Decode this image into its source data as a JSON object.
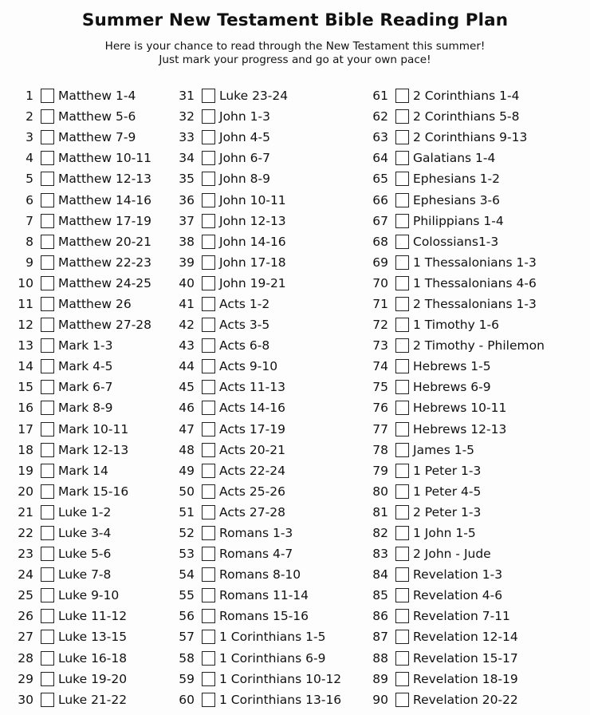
{
  "title": "Summer New Testament Bible Reading Plan",
  "subtitle_lines": [
    "Here is your chance to read through the New Testament this summer!",
    "Just mark your progress and go at your own pace!"
  ],
  "readings": [
    {
      "n": "1",
      "label": "Matthew 1-4",
      "checked": false
    },
    {
      "n": "2",
      "label": "Matthew 5-6",
      "checked": false
    },
    {
      "n": "3",
      "label": "Matthew 7-9",
      "checked": false
    },
    {
      "n": "4",
      "label": "Matthew 10-11",
      "checked": false
    },
    {
      "n": "5",
      "label": "Matthew 12-13",
      "checked": false
    },
    {
      "n": "6",
      "label": "Matthew 14-16",
      "checked": false
    },
    {
      "n": "7",
      "label": "Matthew 17-19",
      "checked": false
    },
    {
      "n": "8",
      "label": "Matthew 20-21",
      "checked": false
    },
    {
      "n": "9",
      "label": "Matthew 22-23",
      "checked": false
    },
    {
      "n": "10",
      "label": "Matthew 24-25",
      "checked": false
    },
    {
      "n": "11",
      "label": "Matthew 26",
      "checked": false
    },
    {
      "n": "12",
      "label": "Matthew 27-28",
      "checked": false
    },
    {
      "n": "13",
      "label": "Mark 1-3",
      "checked": false
    },
    {
      "n": "14",
      "label": "Mark 4-5",
      "checked": false
    },
    {
      "n": "15",
      "label": "Mark 6-7",
      "checked": false
    },
    {
      "n": "16",
      "label": "Mark 8-9",
      "checked": false
    },
    {
      "n": "17",
      "label": "Mark 10-11",
      "checked": false
    },
    {
      "n": "18",
      "label": "Mark 12-13",
      "checked": false
    },
    {
      "n": "19",
      "label": "Mark 14",
      "checked": false
    },
    {
      "n": "20",
      "label": "Mark 15-16",
      "checked": false
    },
    {
      "n": "21",
      "label": "Luke 1-2",
      "checked": false
    },
    {
      "n": "22",
      "label": "Luke 3-4",
      "checked": false
    },
    {
      "n": "23",
      "label": "Luke 5-6",
      "checked": false
    },
    {
      "n": "24",
      "label": "Luke 7-8",
      "checked": false
    },
    {
      "n": "25",
      "label": "Luke 9-10",
      "checked": false
    },
    {
      "n": "26",
      "label": "Luke 11-12",
      "checked": false
    },
    {
      "n": "27",
      "label": "Luke 13-15",
      "checked": false
    },
    {
      "n": "28",
      "label": "Luke 16-18",
      "checked": false
    },
    {
      "n": "29",
      "label": "Luke 19-20",
      "checked": false
    },
    {
      "n": "30",
      "label": "Luke 21-22",
      "checked": false
    },
    {
      "n": "31",
      "label": "Luke 23-24",
      "checked": false
    },
    {
      "n": "32",
      "label": "John 1-3",
      "checked": false
    },
    {
      "n": "33",
      "label": "John 4-5",
      "checked": false
    },
    {
      "n": "34",
      "label": "John 6-7",
      "checked": false
    },
    {
      "n": "35",
      "label": "John 8-9",
      "checked": false
    },
    {
      "n": "36",
      "label": "John 10-11",
      "checked": false
    },
    {
      "n": "37",
      "label": "John 12-13",
      "checked": false
    },
    {
      "n": "38",
      "label": "John 14-16",
      "checked": false
    },
    {
      "n": "39",
      "label": "John 17-18",
      "checked": false
    },
    {
      "n": "40",
      "label": "John 19-21",
      "checked": false
    },
    {
      "n": "41",
      "label": "Acts 1-2",
      "checked": false
    },
    {
      "n": "42",
      "label": "Acts 3-5",
      "checked": false
    },
    {
      "n": "43",
      "label": "Acts 6-8",
      "checked": false
    },
    {
      "n": "44",
      "label": "Acts 9-10",
      "checked": false
    },
    {
      "n": "45",
      "label": "Acts 11-13",
      "checked": false
    },
    {
      "n": "46",
      "label": "Acts 14-16",
      "checked": false
    },
    {
      "n": "47",
      "label": "Acts 17-19",
      "checked": false
    },
    {
      "n": "48",
      "label": "Acts 20-21",
      "checked": false
    },
    {
      "n": "49",
      "label": "Acts 22-24",
      "checked": false
    },
    {
      "n": "50",
      "label": "Acts 25-26",
      "checked": false
    },
    {
      "n": "51",
      "label": "Acts 27-28",
      "checked": false
    },
    {
      "n": "52",
      "label": "Romans 1-3",
      "checked": false
    },
    {
      "n": "53",
      "label": "Romans 4-7",
      "checked": false
    },
    {
      "n": "54",
      "label": "Romans 8-10",
      "checked": false
    },
    {
      "n": "55",
      "label": "Romans 11-14",
      "checked": false
    },
    {
      "n": "56",
      "label": "Romans 15-16",
      "checked": false
    },
    {
      "n": "57",
      "label": "1 Corinthians 1-5",
      "checked": false
    },
    {
      "n": "58",
      "label": "1 Corinthians 6-9",
      "checked": false
    },
    {
      "n": "59",
      "label": "1 Corinthians 10-12",
      "checked": false
    },
    {
      "n": "60",
      "label": "1 Corinthians 13-16",
      "checked": false
    },
    {
      "n": "61",
      "label": "2 Corinthians 1-4",
      "checked": false
    },
    {
      "n": "62",
      "label": "2 Corinthians 5-8",
      "checked": false
    },
    {
      "n": "63",
      "label": "2 Corinthians 9-13",
      "checked": false
    },
    {
      "n": "64",
      "label": "Galatians 1-4",
      "checked": false
    },
    {
      "n": "65",
      "label": "Ephesians 1-2",
      "checked": false
    },
    {
      "n": "66",
      "label": "Ephesians 3-6",
      "checked": false
    },
    {
      "n": "67",
      "label": "Philippians 1-4",
      "checked": false
    },
    {
      "n": "68",
      "label": "Colossians1-3",
      "checked": false
    },
    {
      "n": "69",
      "label": "1 Thessalonians 1-3",
      "checked": false
    },
    {
      "n": "70",
      "label": "1 Thessalonians 4-6",
      "checked": false
    },
    {
      "n": "71",
      "label": "2 Thessalonians 1-3",
      "checked": false
    },
    {
      "n": "72",
      "label": "1 Timothy 1-6",
      "checked": false
    },
    {
      "n": "73",
      "label": "2 Timothy - Philemon",
      "checked": false
    },
    {
      "n": "74",
      "label": "Hebrews 1-5",
      "checked": false
    },
    {
      "n": "75",
      "label": "Hebrews 6-9",
      "checked": false
    },
    {
      "n": "76",
      "label": "Hebrews 10-11",
      "checked": false
    },
    {
      "n": "77",
      "label": "Hebrews 12-13",
      "checked": false
    },
    {
      "n": "78",
      "label": "James 1-5",
      "checked": false
    },
    {
      "n": "79",
      "label": "1 Peter 1-3",
      "checked": false
    },
    {
      "n": "80",
      "label": "1 Peter 4-5",
      "checked": false
    },
    {
      "n": "81",
      "label": "2 Peter 1-3",
      "checked": false
    },
    {
      "n": "82",
      "label": "1 John 1-5",
      "checked": false
    },
    {
      "n": "83",
      "label": "2 John - Jude",
      "checked": false
    },
    {
      "n": "84",
      "label": "Revelation 1-3",
      "checked": false
    },
    {
      "n": "85",
      "label": "Revelation 4-6",
      "checked": false
    },
    {
      "n": "86",
      "label": "Revelation 7-11",
      "checked": false
    },
    {
      "n": "87",
      "label": "Revelation 12-14",
      "checked": false
    },
    {
      "n": "88",
      "label": "Revelation 15-17",
      "checked": false
    },
    {
      "n": "89",
      "label": "Revelation 18-19",
      "checked": false
    },
    {
      "n": "90",
      "label": "Revelation 20-22",
      "checked": false
    }
  ]
}
